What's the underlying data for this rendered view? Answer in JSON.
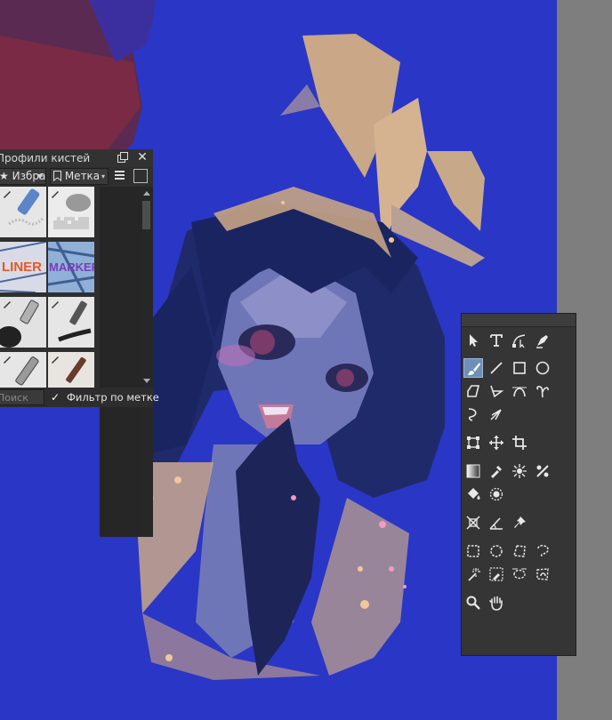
{
  "canvas": {
    "background": "#2a36c6",
    "gutter": "#7e7e7e"
  },
  "brush_presets": {
    "title": "Профили кистей",
    "favorites_combo": "Избранное",
    "tag_combo": "Метка",
    "search_placeholder": "Поиск",
    "filter_label": "Фильтр по метке",
    "filter_checked": true,
    "presets": [
      {
        "name": "blender-marker",
        "art_text": ""
      },
      {
        "name": "eraser-soft",
        "art_text": ""
      },
      {
        "name": "liner",
        "art_text": "LINER"
      },
      {
        "name": "marker",
        "art_text": "MARKER"
      },
      {
        "name": "pencil-soft",
        "art_text": ""
      },
      {
        "name": "pencil-hard",
        "art_text": ""
      },
      {
        "name": "pen-fine",
        "art_text": ""
      },
      {
        "name": "ink-brush",
        "art_text": ""
      }
    ]
  },
  "toolbox": {
    "active_tool": "freehand-brush",
    "tools": [
      "select-shapes",
      "text",
      "edit-shapes",
      "calligraphy",
      "freehand-brush",
      "line",
      "rectangle",
      "ellipse",
      "polygon",
      "polyline",
      "bezier-curve",
      "freehand-path",
      "dynamic-brush",
      "multibrush",
      "transform",
      "move",
      "crop",
      "gradient",
      "color-picker",
      "smart-patch",
      "fill-with-pattern",
      "fill",
      "enclosed-fill",
      "assistant",
      "measure",
      "reference-images",
      "rect-select",
      "ellipse-select",
      "polygon-select",
      "freehand-select",
      "contiguous-select",
      "similar-select",
      "bezier-select",
      "magnetic-select",
      "zoom",
      "pan"
    ]
  }
}
